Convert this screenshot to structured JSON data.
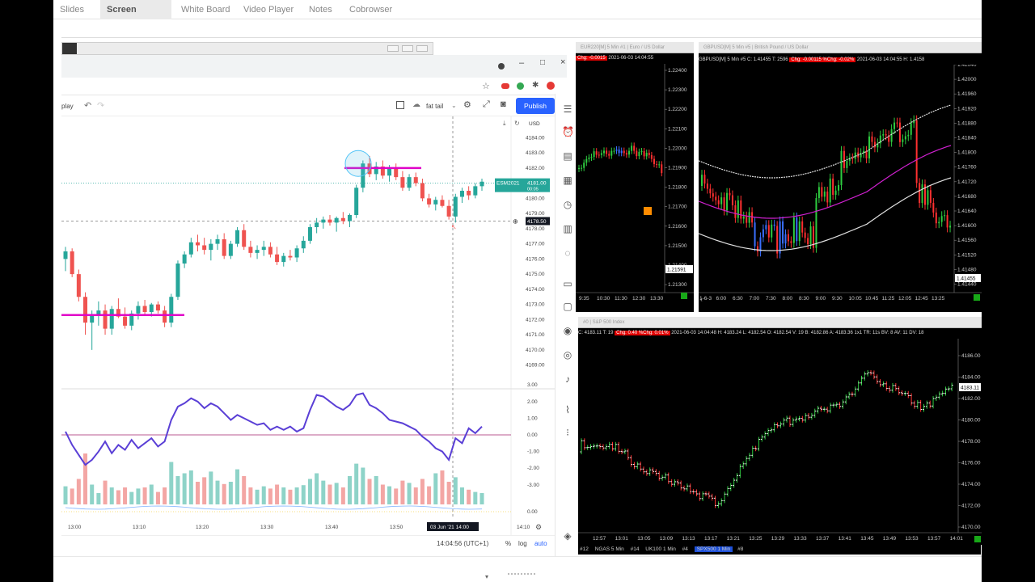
{
  "app_tabs": [
    {
      "label": "Slides",
      "active": false
    },
    {
      "label": "Screen Sharing",
      "active": true
    },
    {
      "label": "White Board",
      "active": false
    },
    {
      "label": "Video Player",
      "active": false
    },
    {
      "label": "Notes",
      "active": false
    },
    {
      "label": "Cobrowser",
      "active": false
    }
  ],
  "tv": {
    "toolbar": {
      "replay_label": "play",
      "style_label": "fat tail",
      "publish_label": "Publish"
    },
    "currency": "USD",
    "price_axis": [
      "4184.00",
      "4183.00",
      "4182.00",
      "4181.00",
      "4180.00",
      "4179.00",
      "4178.00",
      "4177.00",
      "4176.00",
      "4175.00",
      "4174.00",
      "4173.00",
      "4172.00",
      "4171.00",
      "4170.00",
      "4169.00"
    ],
    "symbol_tag": "ESM2021",
    "symbol_price": "4181.00",
    "symbol_timer": "00:05",
    "cursor_price": "4178.50",
    "osc_axis": [
      "3.00",
      "2.00",
      "1.00",
      "0.00",
      "-1.00",
      "-2.00",
      "-3.00",
      "0.00"
    ],
    "time_axis": [
      "13:00",
      "13:10",
      "13:20",
      "13:30",
      "13:40",
      "13:50",
      "14:10"
    ],
    "cursor_time": "03 Jun '21  14:00",
    "status_time": "14:04:56 (UTC+1)",
    "pct_label": "%",
    "log_label": "log",
    "auto_label": "auto",
    "price_min": 4168.5,
    "price_max": 4184.5,
    "candles": [
      [
        4176,
        4176.8,
        4175.2,
        4176.5
      ],
      [
        4176.5,
        4176.7,
        4174.8,
        4175
      ],
      [
        4175,
        4175.3,
        4173.2,
        4173.5
      ],
      [
        4173.5,
        4173.8,
        4171,
        4171.8
      ],
      [
        4171.8,
        4172.6,
        4170,
        4172.3
      ],
      [
        4172.3,
        4173.2,
        4171.6,
        4172.6
      ],
      [
        4172.6,
        4173,
        4171,
        4171.4
      ],
      [
        4171.4,
        4172.9,
        4171,
        4172.7
      ],
      [
        4172.7,
        4173.4,
        4172.1,
        4172.2
      ],
      [
        4172.2,
        4172.8,
        4171.4,
        4171.6
      ],
      [
        4171.6,
        4172.6,
        4171.3,
        4172.4
      ],
      [
        4172.4,
        4173.2,
        4172,
        4172.9
      ],
      [
        4172.9,
        4173.3,
        4172.3,
        4172.5
      ],
      [
        4172.5,
        4173.1,
        4172.2,
        4173
      ],
      [
        4173,
        4173.2,
        4172.4,
        4172.6
      ],
      [
        4172.6,
        4172.9,
        4171.5,
        4171.8
      ],
      [
        4171.8,
        4173.7,
        4171.5,
        4173.5
      ],
      [
        4173.5,
        4175.9,
        4173.3,
        4175.7
      ],
      [
        4175.7,
        4176.5,
        4175.4,
        4176.3
      ],
      [
        4176.3,
        4177.4,
        4176.1,
        4177.1
      ],
      [
        4177.1,
        4177.6,
        4176.5,
        4176.9
      ],
      [
        4176.9,
        4177.4,
        4176.3,
        4176.6
      ],
      [
        4176.6,
        4177.3,
        4175.9,
        4177
      ],
      [
        4177,
        4177.6,
        4176.6,
        4177.3
      ],
      [
        4177.3,
        4177.7,
        4176,
        4176.2
      ],
      [
        4176.2,
        4177.2,
        4176,
        4177
      ],
      [
        4177,
        4178.1,
        4176.8,
        4177.9
      ],
      [
        4177.9,
        4178.3,
        4176.6,
        4176.8
      ],
      [
        4176.8,
        4177.2,
        4176.1,
        4176.4
      ],
      [
        4176.4,
        4176.9,
        4176,
        4176.6
      ],
      [
        4176.6,
        4177.2,
        4176.2,
        4176.8
      ],
      [
        4176.8,
        4177.1,
        4176.1,
        4176.3
      ],
      [
        4176.3,
        4176.8,
        4175.6,
        4175.8
      ],
      [
        4175.8,
        4176.4,
        4175.5,
        4176.2
      ],
      [
        4176.2,
        4176.6,
        4175.9,
        4176.1
      ],
      [
        4176.1,
        4176.9,
        4175.8,
        4176.7
      ],
      [
        4176.7,
        4177.5,
        4176.4,
        4177.2
      ],
      [
        4177.2,
        4178.3,
        4177,
        4178.1
      ],
      [
        4178.1,
        4178.7,
        4177.7,
        4178.4
      ],
      [
        4178.4,
        4178.8,
        4178,
        4178.6
      ],
      [
        4178.6,
        4178.9,
        4178.2,
        4178.4
      ],
      [
        4178.4,
        4178.8,
        4177.8,
        4178.7
      ],
      [
        4178.7,
        4179.1,
        4178.3,
        4178.5
      ],
      [
        4178.5,
        4179,
        4178.1,
        4178.9
      ],
      [
        4178.9,
        4180.9,
        4178.7,
        4180.7
      ],
      [
        4180.7,
        4182.5,
        4180.4,
        4182.3
      ],
      [
        4182.3,
        4182.8,
        4181.4,
        4181.6
      ],
      [
        4181.6,
        4182.4,
        4181.2,
        4182.1
      ],
      [
        4182.1,
        4182.5,
        4181.3,
        4181.5
      ],
      [
        4181.5,
        4182.2,
        4181.1,
        4182
      ],
      [
        4182,
        4182.3,
        4181.2,
        4181.4
      ],
      [
        4181.4,
        4181.8,
        4180.5,
        4180.7
      ],
      [
        4180.7,
        4181.6,
        4180.5,
        4181.4
      ],
      [
        4181.4,
        4181.7,
        4180.8,
        4181
      ],
      [
        4181,
        4181.3,
        4179.8,
        4180
      ],
      [
        4180,
        4180.3,
        4179.4,
        4179.6
      ],
      [
        4179.6,
        4180.1,
        4179.2,
        4179.9
      ],
      [
        4179.9,
        4180.2,
        4179.4,
        4179.5
      ],
      [
        4179.5,
        4179.9,
        4178.6,
        4178.8
      ],
      [
        4178.8,
        4180.3,
        4178.4,
        4180.1
      ],
      [
        4180.1,
        4180.7,
        4179.7,
        4180.5
      ],
      [
        4180.5,
        4180.8,
        4179.9,
        4180.2
      ],
      [
        4180.2,
        4181,
        4180,
        4180.8
      ],
      [
        4180.8,
        4181.3,
        4180.5,
        4181.1
      ]
    ],
    "osc": [
      0.2,
      -0.6,
      -1.2,
      -1.8,
      -1.5,
      -1.0,
      -0.4,
      -1.1,
      -0.6,
      -0.9,
      -0.3,
      -0.8,
      -0.5,
      -0.2,
      -0.7,
      -0.4,
      0.9,
      1.7,
      1.9,
      2.2,
      2.0,
      1.6,
      1.9,
      1.7,
      1.3,
      0.9,
      1.2,
      1.0,
      0.8,
      0.6,
      0.7,
      0.3,
      0.5,
      0.3,
      0.5,
      0.2,
      0.4,
      1.5,
      2.4,
      2.3,
      2.0,
      1.7,
      1.5,
      1.8,
      2.4,
      2.5,
      1.8,
      1.6,
      1.3,
      0.9,
      0.8,
      0.7,
      0.5,
      0.3,
      -0.1,
      -0.4,
      -0.8,
      -1.0,
      -1.5,
      -0.2,
      -0.5,
      0.4,
      0.1,
      0.5
    ],
    "volume": [
      0.32,
      0.28,
      0.45,
      0.9,
      0.35,
      0.2,
      0.42,
      0.3,
      0.25,
      0.3,
      0.22,
      0.28,
      0.3,
      0.35,
      0.22,
      0.3,
      0.75,
      0.5,
      0.55,
      0.6,
      0.4,
      0.48,
      0.58,
      0.42,
      0.36,
      0.4,
      0.62,
      0.5,
      0.3,
      0.26,
      0.32,
      0.28,
      0.35,
      0.3,
      0.26,
      0.3,
      0.34,
      0.45,
      0.55,
      0.42,
      0.35,
      0.38,
      0.3,
      0.5,
      0.72,
      0.65,
      0.45,
      0.5,
      0.35,
      0.32,
      0.28,
      0.42,
      0.38,
      0.3,
      0.45,
      0.32,
      0.55,
      0.6,
      0.4,
      0.48,
      0.3,
      0.26,
      0.22,
      0.2
    ]
  },
  "eur_window": {
    "title": "EUR220[M]  5 Min  #1 | Euro / US Dollar",
    "info_time": "2021-06-03 14:04:55",
    "info_chg": "Chg: -0.0015",
    "price_axis": [
      "1.22400",
      "1.22300",
      "1.22200",
      "1.22100",
      "1.22000",
      "1.21900",
      "1.21800",
      "1.21700",
      "1.21600",
      "1.21500",
      "1.21400",
      "1.21300"
    ],
    "last_price": "1.21591",
    "time_axis": [
      "9:35",
      "10:30",
      "11:30",
      "12:30",
      "13:30"
    ]
  },
  "gbp_window": {
    "title": "GBPUSD[M]  5 Min  #5 | British Pound / US Dollar",
    "info_sym": "GBPUSD[M]  5 Min  #5",
    "info_c": "C: 1.41455  T: 2596",
    "info_chg": "Chg: -0.00115  %Chg: -0.02%",
    "info_time": "2021-06-03 14:04:55  H: 1.4158",
    "price_axis": [
      "1.42040",
      "1.42000",
      "1.41960",
      "1.41920",
      "1.41880",
      "1.41840",
      "1.41800",
      "1.41760",
      "1.41720",
      "1.41680",
      "1.41640",
      "1.41600",
      "1.41560",
      "1.41520",
      "1.41480",
      "1.41440"
    ],
    "last_price": "1.41455",
    "time_axis": [
      "1-6-3",
      "6:00",
      "6:30",
      "7:00",
      "7:30",
      "8:00",
      "8:30",
      "9:00",
      "9:30",
      "10:05",
      "10:45",
      "11:25",
      "12:05",
      "12:45",
      "13:25"
    ]
  },
  "spx_window": {
    "title": "#0 | S&P 500 Index",
    "info_c": "C: 4183.11  T: 19",
    "info_chg": "Chg: 0.40  %Chg: 0.01%",
    "info_rest": "2021-06-03 14:04:48  H: 4183.24  L: 4182.54  O: 4182.54  V: 19  B: 4182.86  A: 4183.36  1x1  TR: 11s  BV: 8  AV: 11  DV: 18",
    "price_axis": [
      "4186.00",
      "4184.00",
      "4182.00",
      "4180.00",
      "4178.00",
      "4176.00",
      "4174.00",
      "4172.00",
      "4170.00"
    ],
    "last_price": "4183.11",
    "time_axis": [
      "12:57",
      "13:01",
      "13:05",
      "13:09",
      "13:13",
      "13:17",
      "13:21",
      "13:25",
      "13:29",
      "13:33",
      "13:37",
      "13:41",
      "13:45",
      "13:49",
      "13:53",
      "13:57",
      "14:01"
    ]
  },
  "bottom_tabs": [
    "#12",
    "NGAS  5 Min",
    "#14",
    "UK100  1 Min",
    "#4",
    "SPX500  1 Min",
    "#8"
  ],
  "colors": {
    "bull": "#26a69a",
    "bear": "#ef5350",
    "magenta": "#e000c8",
    "osc": "#5a3fd6",
    "blue": "#2962ff"
  }
}
